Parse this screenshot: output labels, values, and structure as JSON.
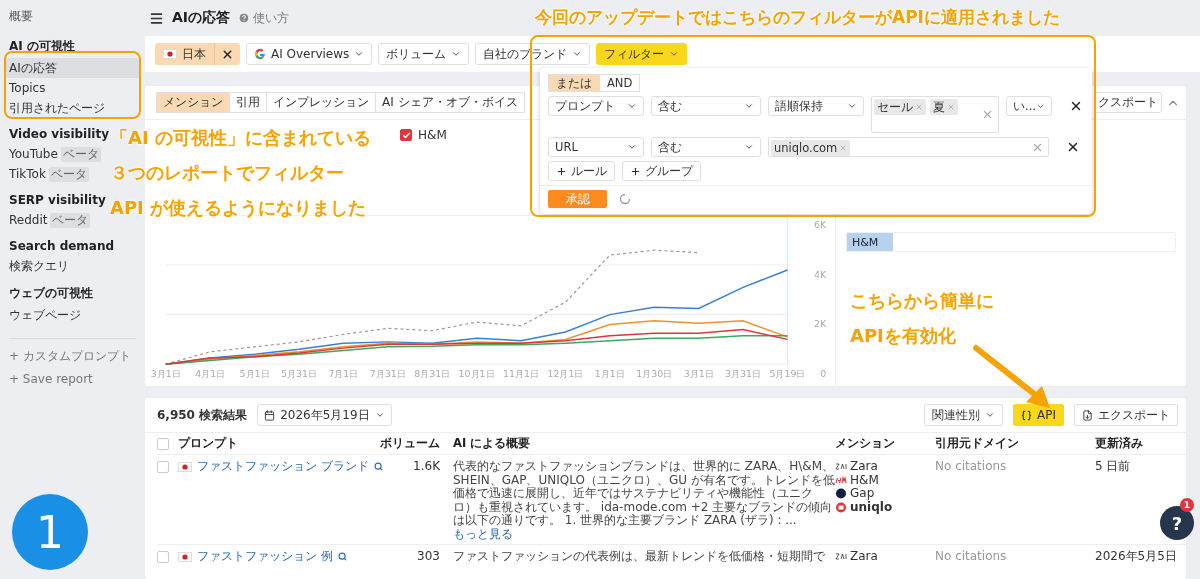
{
  "sidebar": {
    "top_link": "概要",
    "sections": [
      {
        "title": "AI の可視性",
        "items": [
          {
            "label": "AIの応答",
            "selected": true
          },
          {
            "label": "Topics",
            "selected": false
          },
          {
            "label": "引用されたページ",
            "selected": false
          }
        ]
      },
      {
        "title": "Video visibility",
        "items": [
          {
            "label": "YouTube",
            "badge": "ベータ",
            "selected": false
          },
          {
            "label": "TikTok",
            "badge": "ベータ",
            "selected": false
          }
        ]
      },
      {
        "title": "SERP visibility",
        "items": [
          {
            "label": "Reddit",
            "badge": "ベータ",
            "selected": false
          }
        ]
      },
      {
        "title": "Search demand",
        "items": [
          {
            "label": "検索クエリ",
            "selected": false
          }
        ]
      },
      {
        "title": "ウェブの可視性",
        "items": [
          {
            "label": "ウェブページ",
            "selected": false
          }
        ]
      }
    ],
    "actions": [
      "+ カスタムプロンプト",
      "+ Save report"
    ]
  },
  "header": {
    "title": "AIの応答",
    "help": "使い方"
  },
  "filter_bar": [
    {
      "kind": "country",
      "label": "日本"
    },
    {
      "kind": "engine",
      "label": "AI Overviews"
    },
    {
      "kind": "dropdown",
      "label": "ボリューム"
    },
    {
      "kind": "dropdown",
      "label": "自社のブランド"
    },
    {
      "kind": "active",
      "label": "フィルター"
    }
  ],
  "filter_popup": {
    "logic": [
      {
        "label": "または",
        "selected": true
      },
      {
        "label": "AND",
        "selected": false
      }
    ],
    "rules": [
      {
        "field": "プロンプト",
        "operator": "含む",
        "mode": "語順保持",
        "tags": [
          "セール",
          "夏"
        ],
        "extra": "い..."
      },
      {
        "field": "URL",
        "operator": "含む",
        "tags": [
          "uniqlo.com"
        ]
      }
    ],
    "add_buttons": [
      "ルール",
      "グループ"
    ],
    "apply": "承認",
    "loading": true
  },
  "chart_card": {
    "tabs": [
      {
        "label": "メンション",
        "selected": true
      },
      {
        "label": "引用",
        "selected": false
      },
      {
        "label": "インプレッション",
        "selected": false
      },
      {
        "label": "AI シェア・オブ・ボイス",
        "selected": false
      }
    ],
    "export": "クスポート",
    "legend": [
      {
        "checked": true
      }
    ],
    "chart_data": {
      "type": "line",
      "categories": [
        "3月1日",
        "4月1日",
        "5月1日",
        "5月31日",
        "7月1日",
        "7月31日",
        "8月31日",
        "10月1日",
        "11月1日",
        "12月1日",
        "1月1日",
        "1月30日",
        "3月1日",
        "3月31日",
        "5月19日"
      ],
      "ylim": [
        0,
        6000
      ],
      "grid": true,
      "yticks": [
        {
          "value": 0,
          "label": "0"
        },
        {
          "value": 2000,
          "label": "2K"
        },
        {
          "value": 4000,
          "label": "4K"
        },
        {
          "value": 6000,
          "label": "6K"
        }
      ],
      "series": [
        {
          "color": "#9a9a9a",
          "line_style": "dashed",
          "values": [
            0,
            500,
            700,
            900,
            1200,
            1450,
            1350,
            1700,
            1550,
            2500,
            4400,
            4600,
            4500,
            null,
            null
          ]
        },
        {
          "color": "#3b7fd0",
          "values": [
            0,
            250,
            400,
            600,
            850,
            900,
            850,
            1050,
            950,
            1300,
            2000,
            2300,
            2250,
            3100,
            3800
          ]
        },
        {
          "color": "#f0922b",
          "values": [
            0,
            200,
            350,
            500,
            700,
            850,
            800,
            900,
            850,
            1000,
            1600,
            1750,
            1650,
            1750,
            1100
          ]
        },
        {
          "color": "#3aaa5c",
          "values": [
            0,
            150,
            300,
            400,
            550,
            700,
            720,
            780,
            780,
            850,
            950,
            1050,
            1050,
            1150,
            1150
          ]
        },
        {
          "name": "H&M",
          "color": "#e0353b",
          "values": [
            0,
            250,
            300,
            450,
            650,
            800,
            800,
            850,
            850,
            950,
            1150,
            1250,
            1250,
            1400,
            1000
          ]
        }
      ]
    },
    "bars": [
      {
        "label": "H&M",
        "level": 0.14
      }
    ]
  },
  "results": {
    "count": "6,950 検索結果",
    "date": "2026年5月19日",
    "sort": "関連性別",
    "api": "API",
    "export": "エクスポート",
    "all_checked": false,
    "columns": [
      "プロンプト",
      "ボリューム",
      "AI による概要",
      "メンション",
      "引用元ドメイン",
      "更新済み"
    ],
    "rows": [
      {
        "checked": false,
        "prompt": "ファストファッション ブランド",
        "volume": "1.6K",
        "overview": "代表的なファストファッションブランドは、世界的に ZARA、H\\&M、SHEIN、GAP、UNIQLO（ユニクロ）、GU が有名です。トレンドを低価格で迅速に展開し、近年ではサステナビリティや機能性（ユニクロ）も重視されています。 ida-mode.com +2 主要なブランドの傾向は以下の通りです。 1. 世界的な主要ブランド ZARA (ザラ) :",
        "ellipsis": "...",
        "more": "もっと見る",
        "mentions": [
          {
            "kind": "zara",
            "name": "Zara",
            "own": false
          },
          {
            "kind": "hm",
            "name": "H&M",
            "own": false
          },
          {
            "kind": "gap",
            "name": "Gap",
            "own": false
          },
          {
            "kind": "uniqlo",
            "name": "uniqlo",
            "own": true
          }
        ],
        "citations": "No citations",
        "updated": "5 日前"
      },
      {
        "checked": false,
        "prompt": "ファストファッション 例",
        "volume": "303",
        "overview": "ファストファッションの代表例は、最新トレンドを低価格・短期間で",
        "mentions": [
          {
            "kind": "zara",
            "name": "Zara",
            "own": false
          }
        ],
        "citations": "No citations",
        "updated": "2026年5月5日"
      }
    ]
  },
  "annotations": {
    "headline": "今回のアップデートではこちらのフィルターがAPIに適用されました",
    "left": [
      "「AI の可視性」に含まれている",
      "３つのレポートでフィルター",
      "API が使えるようになりました"
    ],
    "right": [
      "こちらから簡単に",
      "APIを有効化"
    ],
    "step": "1"
  },
  "help": {
    "label": "?",
    "badge": "1"
  }
}
